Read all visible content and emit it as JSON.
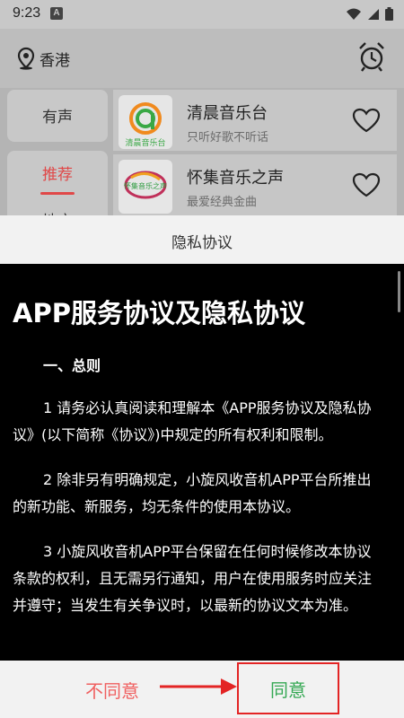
{
  "status_bar": {
    "time": "9:23",
    "app_badge": "A",
    "icons": [
      "wifi-icon",
      "signal-icon",
      "battery-icon"
    ]
  },
  "header": {
    "location": "香港",
    "location_icon": "location-pin-icon",
    "alarm_icon": "alarm-clock-icon"
  },
  "tabs": [
    {
      "label": "有声",
      "selected": false
    },
    {
      "label": "推荐",
      "selected": true,
      "color": "#e04848"
    },
    {
      "label": "地方",
      "partially_visible": true
    }
  ],
  "stations": [
    {
      "name": "清晨音乐台",
      "subtitle": "只听好歌不听话",
      "logo_text": "清晨音乐台",
      "logo_color": "#3aa845"
    },
    {
      "name": "怀集音乐之声",
      "subtitle": "最爱经典金曲",
      "logo_text": "怀集音乐之声",
      "logo_color": "#2a9a3c"
    }
  ],
  "dialog": {
    "title": "隐私协议",
    "doc_title": "APP服务协议及隐私协议",
    "section": "一、总则",
    "paragraphs": [
      "1 请务必认真阅读和理解本《APP服务协议及隐私协议》(以下简称《协议》)中规定的所有权利和限制。",
      "2 除非另有明确规定，小旋风收音机APP平台所推出的新功能、新服务，均无条件的使用本协议。",
      "3 小旋风收音机APP平台保留在任何时候修改本协议条款的权利，且无需另行通知，用户在使用服务时应关注并遵守；当发生有关争议时，以最新的协议文本为准。"
    ],
    "disagree_label": "不同意",
    "agree_label": "同意"
  },
  "colors": {
    "disagree": "#f06060",
    "agree": "#34a853",
    "highlight_box": "#e32424"
  }
}
